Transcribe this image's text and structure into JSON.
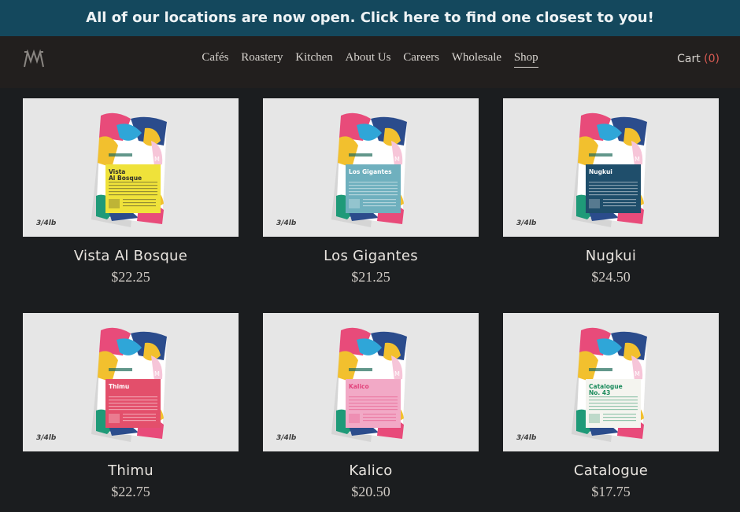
{
  "announcement": "All of our locations are now open. Click here to find one closest to you!",
  "nav": {
    "items": [
      "Cafés",
      "Roastery",
      "Kitchen",
      "About Us",
      "Careers",
      "Wholesale",
      "Shop"
    ],
    "active": "Shop"
  },
  "cart": {
    "label": "Cart",
    "count": "(0)"
  },
  "products": [
    {
      "name": "Vista Al Bosque",
      "price": "$22.25",
      "weight": "3/4lb",
      "label_text": "Vista Al Bosque",
      "label_color": "#efe23a",
      "text_color": "#2d2d2d"
    },
    {
      "name": "Los Gigantes",
      "price": "$21.25",
      "weight": "3/4lb",
      "label_text": "Los Gigantes",
      "label_color": "#6fb0be",
      "text_color": "#ffffff"
    },
    {
      "name": "Nugkui",
      "price": "$24.50",
      "weight": "3/4lb",
      "label_text": "Nugkui",
      "label_color": "#1f4e6b",
      "text_color": "#ffffff"
    },
    {
      "name": "Thimu",
      "price": "$22.75",
      "weight": "3/4lb",
      "label_text": "Thimu",
      "label_color": "#e34f6b",
      "text_color": "#ffffff"
    },
    {
      "name": "Kalico",
      "price": "$20.50",
      "weight": "3/4lb",
      "label_text": "Kalico",
      "label_color": "#f2a9c6",
      "text_color": "#e2427b"
    },
    {
      "name": "Catalogue",
      "price": "$17.75",
      "weight": "3/4lb",
      "label_text": "Catalogue No. 43",
      "label_color": "#f4f4ef",
      "text_color": "#1b8b5c"
    }
  ],
  "colors": {
    "announcement_bg": "#14485d",
    "header_bg": "#221f1e",
    "page_bg": "#1b1d1f",
    "cart_count": "#d85a52"
  },
  "icons": {
    "logo": "monogram-logo"
  }
}
